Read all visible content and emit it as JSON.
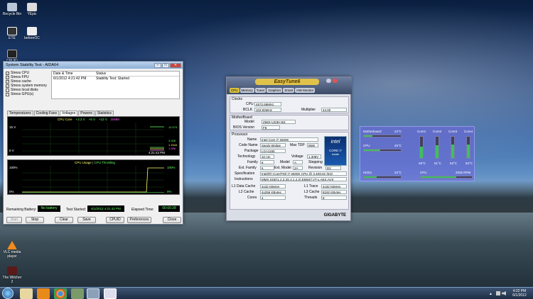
{
  "desktop": {
    "icons": [
      {
        "label": "Recycle Bin"
      },
      {
        "label": "YEpic"
      },
      {
        "label": "ETE"
      },
      {
        "label": "beforeOC"
      },
      {
        "label": "CPUID"
      },
      {
        "label": "VLC media player"
      },
      {
        "label": "The Witcher 2"
      }
    ]
  },
  "stability": {
    "title": "System Stability Test - AIDA64",
    "checks": [
      "Stress CPU",
      "Stress FPU",
      "Stress cache",
      "Stress system memory",
      "Stress local disks",
      "Stress GPU(s)"
    ],
    "log_headers": {
      "date": "Date & Time",
      "status": "Status"
    },
    "log_row": {
      "date": "6/1/2012 4:21:42 PM",
      "status": "Stability Test: Started"
    },
    "tabs": [
      "Temperatures",
      "Cooling Fans",
      "Voltages",
      "Powers",
      "Statistics"
    ],
    "legend": [
      "CPU Core",
      "+3.3 V",
      "+5 V",
      "+12 V",
      "DIMM"
    ],
    "graph1": {
      "ytop": "15 V",
      "ybot": "0 V",
      "time": "4:21:42 PM",
      "vals": [
        "12.074",
        "3.328",
        "1.1544",
        "1.396"
      ]
    },
    "graph2": {
      "title1": "CPU Usage",
      "sep": "|",
      "title2": "CPU Throttling",
      "ytop": "100%",
      "ybot": "0%",
      "rtop": "100%",
      "rbot": "0%"
    },
    "battery_label": "Remaining Battery:",
    "battery": "No battery",
    "started_label": "Test Started:",
    "started": "6/1/2012 4:21:42 PM",
    "elapsed_label": "Elapsed Time:",
    "elapsed": "00:00:28",
    "buttons": [
      "Start",
      "Stop",
      "Clear",
      "Save",
      "CPUID",
      "Preferences",
      "Close"
    ]
  },
  "easytune": {
    "logo": "EasyTune6",
    "tabs": [
      "CPU",
      "Memory",
      "Tuner",
      "Graphics",
      "Smart",
      "HW Monitor"
    ],
    "clocks": {
      "title": "Clocks",
      "cpu_label": "CPU",
      "cpu": "4572.69MHz",
      "bclk_label": "BCLK",
      "bclk": "103.92MHz",
      "mult_label": "Multiplier",
      "mult": "44.00"
    },
    "mobo": {
      "title": "MotherBoard",
      "model_label": "Model",
      "model": "Z68X-UD3H-B3",
      "bios_label": "BIOS Version",
      "bios": "F8"
    },
    "proc": {
      "title": "Processor",
      "name_label": "Name",
      "name": "Intel Core i7 2600K",
      "code_label": "Code Name",
      "code": "Sandy Bridge",
      "tdp_label": "Max TDP",
      "tdp": "95W",
      "pkg_label": "Package",
      "pkg": "LGA1155",
      "tech_label": "Technology",
      "tech": "32 nm",
      "volt_label": "Voltage",
      "volt": "1.308V",
      "fam_label": "Family",
      "fam": "6",
      "model_label": "Model",
      "model": "A",
      "step_label": "Stepping",
      "step": "7",
      "extfam_label": "Ext. Family",
      "extfam": "6",
      "extmod_label": "Ext. Model",
      "extmod": "2A",
      "rev_label": "Revision",
      "rev": "D2",
      "spec_label": "Specification",
      "spec": "Intel(R) Core(TM) i7-2600K CPU @ 3.40GHz (ES)",
      "instr_label": "Instructions",
      "instr": "MMX,SSE(1,2,3,3S,4.1,4.2),EM64T,VT-x,AES,AVX",
      "l1d_label": "L1 Data Cache",
      "l1d": "4x32 KBytes",
      "l1t_label": "L1 Trace",
      "l1t": "4x32 KBytes",
      "l2_label": "L2 Cache",
      "l2": "4x256 KBytes",
      "l3_label": "L3 Cache",
      "l3": "8192 KBytes",
      "cores_label": "Cores",
      "cores": "4",
      "threads_label": "Threads",
      "threads": "8"
    },
    "badge": {
      "brand": "intel",
      "line1": "CORE i7",
      "line2": "inside"
    },
    "footer": "GIGABYTE"
  },
  "gadget": {
    "mb_label": "Motherboard",
    "mb": "24°C",
    "cpu_label": "CPU",
    "cpu": "45°C",
    "hdd_label": "HDD1",
    "hdd": "34°C",
    "cores": [
      {
        "label": "Core1",
        "temp": "49°C",
        "level": 0.55
      },
      {
        "label": "Core2",
        "temp": "51°C",
        "level": 0.6
      },
      {
        "label": "Core3",
        "temp": "53°C",
        "level": 0.62
      },
      {
        "label": "Core4",
        "temp": "53°C",
        "level": 0.62
      }
    ],
    "fan_label": "CPU",
    "fan": "2025 RPM"
  },
  "taskbar": {
    "time": "4:22 PM",
    "date": "6/1/2012"
  }
}
